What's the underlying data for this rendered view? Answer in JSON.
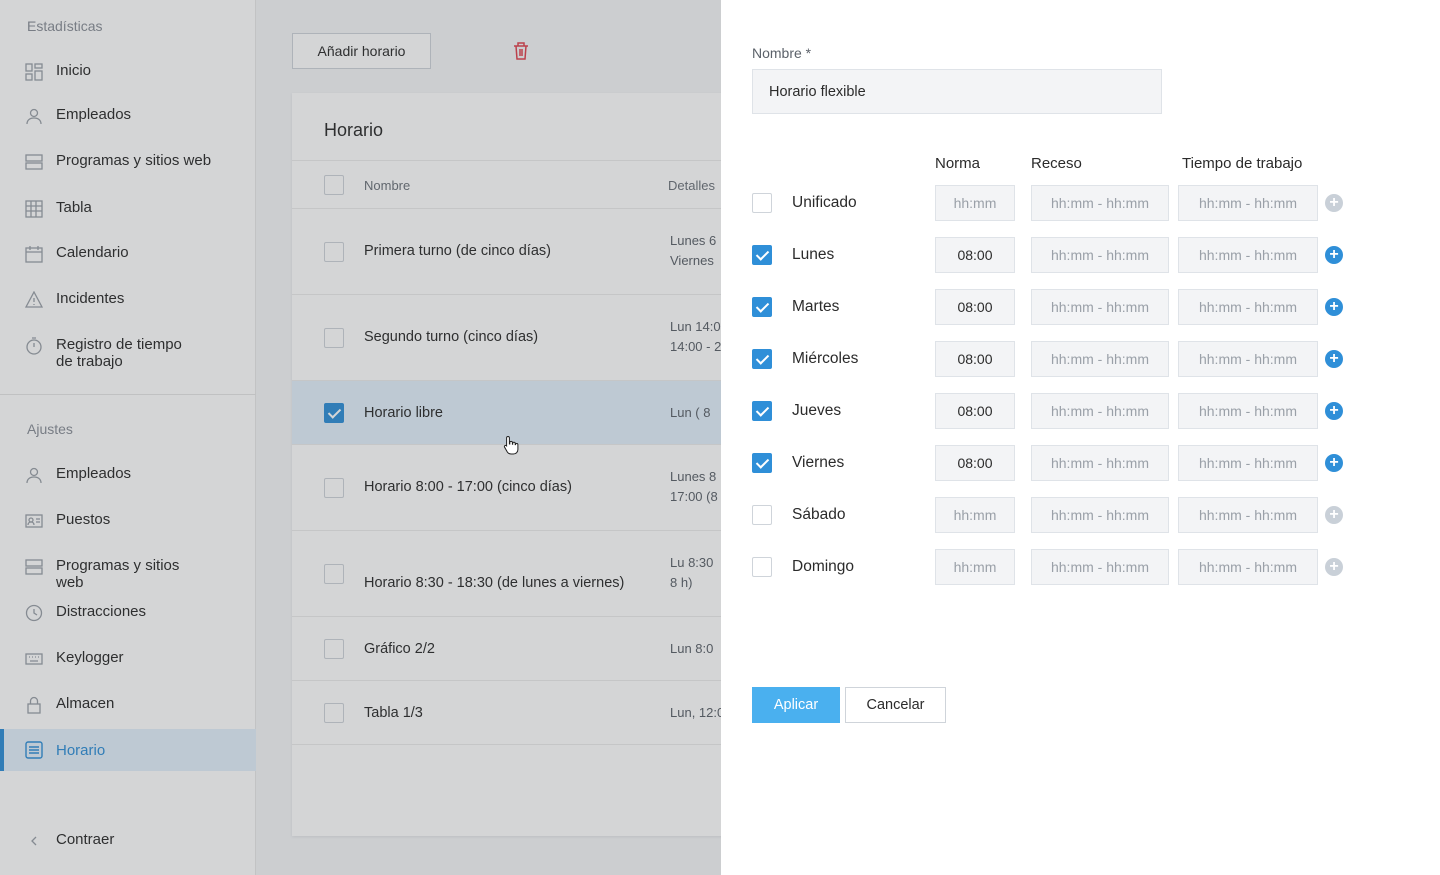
{
  "sidebar": {
    "stats_title": "Estadísticas",
    "stats_items": [
      {
        "label": "Inicio",
        "icon": "dashboard-icon"
      },
      {
        "label": "Empleados",
        "icon": "user-icon"
      },
      {
        "label": "Programas y sitios web",
        "icon": "apps-icon"
      },
      {
        "label": "Tabla",
        "icon": "table-icon"
      },
      {
        "label": "Calendario",
        "icon": "calendar-icon"
      },
      {
        "label": "Incidentes",
        "icon": "warning-icon"
      },
      {
        "label": "Registro de tiempo de trabajo",
        "icon": "stopwatch-icon"
      }
    ],
    "settings_title": "Ajustes",
    "settings_items": [
      {
        "label": "Empleados",
        "icon": "user-icon"
      },
      {
        "label": "Puestos",
        "icon": "id-card-icon"
      },
      {
        "label": "Programas y sitios web",
        "icon": "apps-icon"
      },
      {
        "label": "Distracciones",
        "icon": "clock-icon"
      },
      {
        "label": "Keylogger",
        "icon": "keyboard-icon"
      },
      {
        "label": "Almacen",
        "icon": "lock-icon"
      },
      {
        "label": "Horario",
        "icon": "schedule-icon",
        "active": true
      }
    ],
    "collapse_label": "Contraer"
  },
  "main": {
    "add_button": "Añadir horario",
    "card_title": "Horario",
    "columns": {
      "name": "Nombre",
      "details": "Detalles"
    },
    "rows": [
      {
        "name": "Primera turno (de cinco días)",
        "details": [
          "Lunes 6",
          "Viernes"
        ],
        "checked": false
      },
      {
        "name": "Segundo turno (cinco días)",
        "details": [
          "Lun 14:0",
          "14:00 - 2"
        ],
        "checked": false
      },
      {
        "name": "Horario libre",
        "details": [
          "Lun  ( 8"
        ],
        "checked": true
      },
      {
        "name": "Horario 8:00 - 17:00 (cinco días)",
        "details": [
          "Lunes 8",
          "17:00 (8"
        ],
        "checked": false
      },
      {
        "name": "Horario 8:30 - 18:30 (de lunes a viernes)",
        "details": [
          "Lu  8:30",
          "8 h)"
        ],
        "checked": false
      },
      {
        "name": "Gráfico 2/2",
        "details": [
          "Lun 8:0"
        ],
        "checked": false
      },
      {
        "name": "Tabla 1/3",
        "details": [
          "Lun, 12:0"
        ],
        "checked": false
      }
    ]
  },
  "drawer": {
    "name_label": "Nombre *",
    "name_value": "Horario flexible",
    "headers": {
      "norma": "Norma",
      "receso": "Receso",
      "tiempo": "Tiempo de trabajo"
    },
    "placeholders": {
      "norma": "hh:mm",
      "range": "hh:mm - hh:mm"
    },
    "days": [
      {
        "name": "Unificado",
        "checked": false,
        "norma": ""
      },
      {
        "name": "Lunes",
        "checked": true,
        "norma": "08:00"
      },
      {
        "name": "Martes",
        "checked": true,
        "norma": "08:00"
      },
      {
        "name": "Miércoles",
        "checked": true,
        "norma": "08:00"
      },
      {
        "name": "Jueves",
        "checked": true,
        "norma": "08:00"
      },
      {
        "name": "Viernes",
        "checked": true,
        "norma": "08:00"
      },
      {
        "name": "Sábado",
        "checked": false,
        "norma": ""
      },
      {
        "name": "Domingo",
        "checked": false,
        "norma": ""
      }
    ],
    "apply_label": "Aplicar",
    "cancel_label": "Cancelar"
  },
  "colors": {
    "accent": "#2f8fd8",
    "apply": "#4ab0ef",
    "danger": "#e0414e"
  }
}
